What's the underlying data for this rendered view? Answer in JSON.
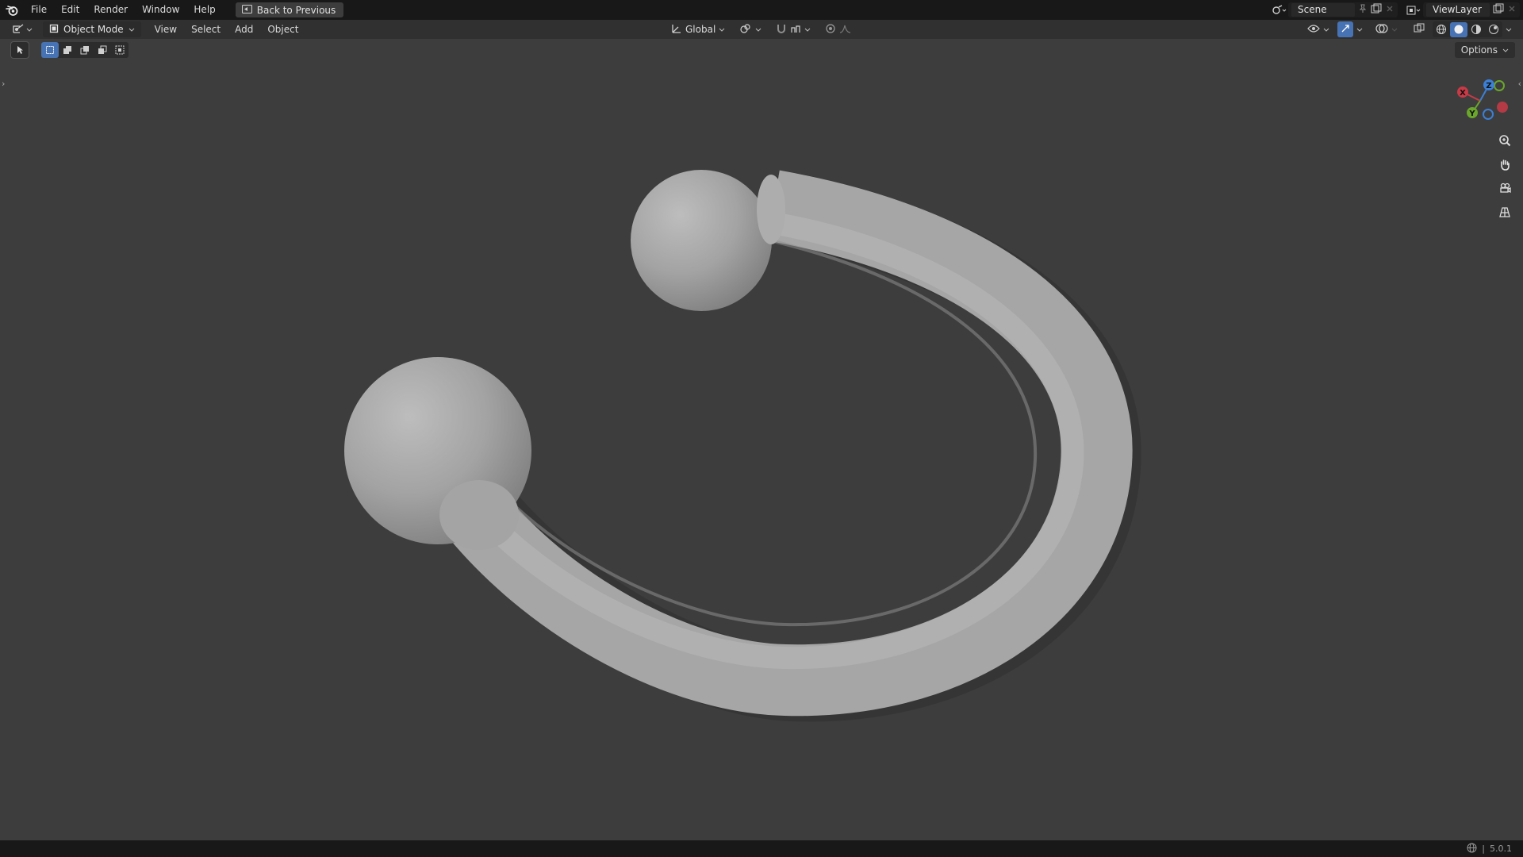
{
  "topbar": {
    "menus": [
      "File",
      "Edit",
      "Render",
      "Window",
      "Help"
    ],
    "back_label": "Back to Previous",
    "scene_label": "Scene",
    "view_layer_label": "ViewLayer"
  },
  "header": {
    "mode_label": "Object Mode",
    "menus": [
      "View",
      "Select",
      "Add",
      "Object"
    ],
    "transform_orientation": "Global"
  },
  "viewport": {
    "options_label": "Options",
    "gizmo": {
      "x_label": "X",
      "y_label": "Y",
      "z_label": "Z"
    },
    "colors": {
      "x_axis": "#c93a47",
      "y_axis": "#6aa72b",
      "z_axis": "#3b7fd6",
      "background": "#3d3d3d",
      "object": "#a8a8a8"
    }
  },
  "statusbar": {
    "version": "5.0.1"
  }
}
